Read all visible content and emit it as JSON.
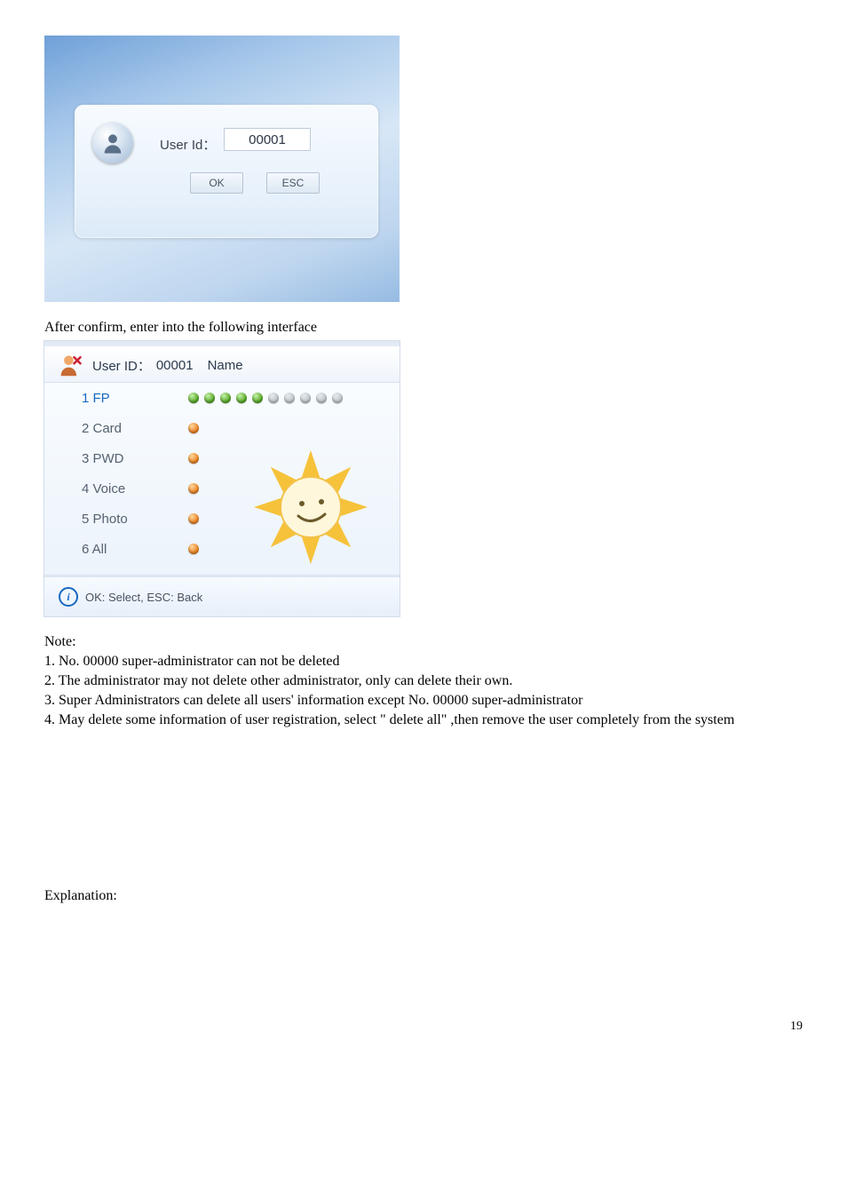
{
  "screenshot1": {
    "userid_label": "User Id：",
    "userid_value": "00001",
    "ok_label": "OK",
    "esc_label": "ESC"
  },
  "text_after_shot1": "After confirm, enter into the following interface",
  "screenshot2": {
    "header_userid_label": "User ID：",
    "header_userid_value": "00001",
    "header_name_label": "Name",
    "items": {
      "fp": "1 FP",
      "card": "2 Card",
      "pwd": "3 PWD",
      "voice": "4 Voice",
      "photo": "5 Photo",
      "all": "6 All"
    },
    "fp_dots": {
      "filled": 5,
      "total": 10
    },
    "footer": "OK: Select, ESC: Back"
  },
  "note_heading": "Note:",
  "notes": {
    "n1": "1. No. 00000 super-administrator can not be deleted",
    "n2": "2. The administrator may not delete other administrator, only can delete their own.",
    "n3": "3. Super Administrators can delete all users' information except No. 00000 super-administrator",
    "n4": "4. May delete some information of user registration, select \" delete all\" ,then remove the user completely from the system"
  },
  "explanation_heading": "Explanation:",
  "page_number": "19"
}
